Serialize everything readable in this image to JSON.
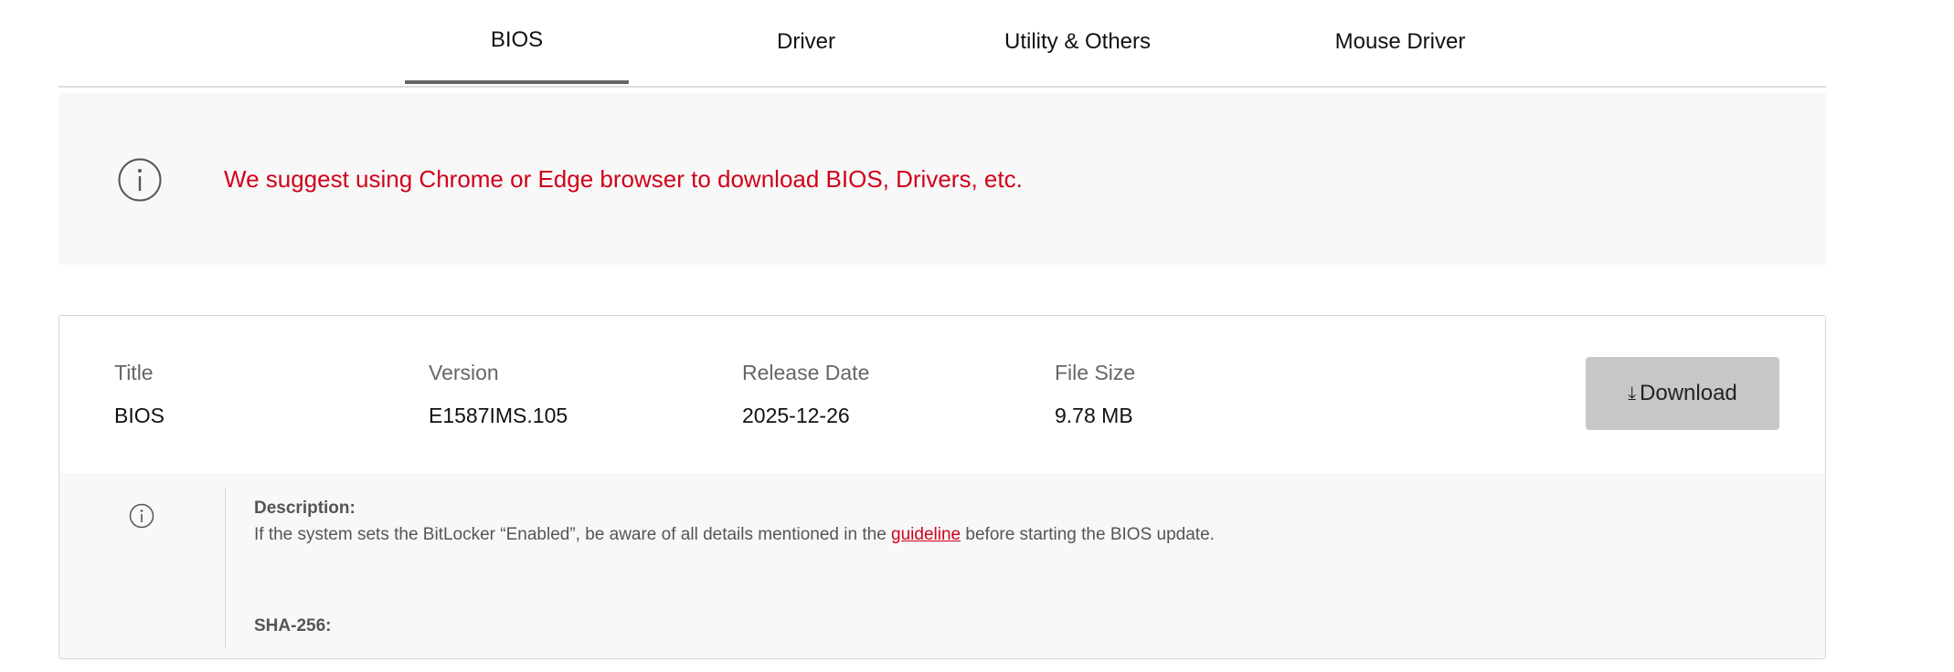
{
  "tabs": [
    {
      "label": "BIOS",
      "active": true
    },
    {
      "label": "Driver",
      "active": false
    },
    {
      "label": "Utility & Others",
      "active": false
    },
    {
      "label": "Mouse Driver",
      "active": false
    }
  ],
  "notice": {
    "icon": "info-icon",
    "text": "We suggest using Chrome or Edge browser to download BIOS, Drivers, etc.",
    "color": "#d0021b"
  },
  "bios_entry": {
    "columns": [
      {
        "label": "Title",
        "value": "BIOS"
      },
      {
        "label": "Version",
        "value": "E1587IMS.105"
      },
      {
        "label": "Release Date",
        "value": "2025-12-26"
      },
      {
        "label": "File Size",
        "value": "9.78 MB"
      }
    ],
    "download_icon": "download-arrow-icon",
    "download_label": "Download",
    "description": {
      "icon": "info-icon",
      "title": "Description:",
      "text_before": "If the system sets the BitLocker “Enabled”, be aware of all details mentioned in the",
      "link_text": "guideline",
      "text_after": "before starting the BIOS update.",
      "sha_title": "SHA-256:"
    }
  },
  "colors": {
    "accent_red": "#d0021b",
    "button_gray": "#c7c7c7",
    "panel_bg": "#f8f8f8"
  }
}
